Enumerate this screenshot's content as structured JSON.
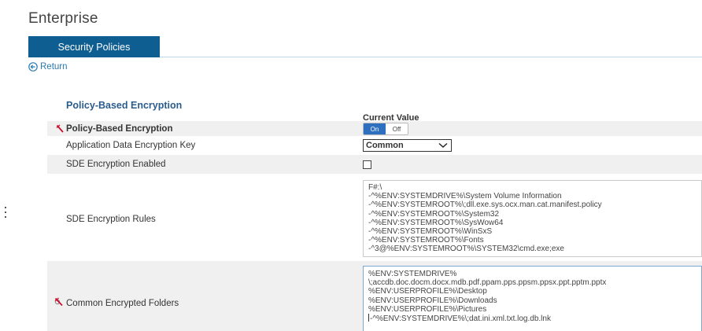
{
  "page": {
    "title": "Enterprise"
  },
  "tabs": [
    {
      "label": "Security Policies",
      "active": true
    }
  ],
  "nav": {
    "return_label": "Return"
  },
  "section": {
    "title": "Policy-Based Encryption",
    "column_header": "Current Value"
  },
  "rows": {
    "policy_encryption": {
      "label": "Policy-Based Encryption",
      "toggle": {
        "on_label": "On",
        "off_label": "Off",
        "selected": "On"
      },
      "icon": "lock-icon"
    },
    "app_data_key": {
      "label": "Application Data Encryption Key",
      "value": "Common"
    },
    "sde_enabled": {
      "label": "SDE Encryption Enabled",
      "checked": false
    },
    "sde_rules": {
      "label": "SDE Encryption Rules",
      "lines": [
        "F#:\\",
        "-^%ENV:SYSTEMDRIVE%\\System Volume Information",
        "-^%ENV:SYSTEMROOT%\\;dll.exe.sys.ocx.man.cat.manifest.policy",
        "-^%ENV:SYSTEMROOT%\\System32",
        "-^%ENV:SYSTEMROOT%\\SysWow64",
        "-^%ENV:SYSTEMROOT%\\WinSxS",
        "-^%ENV:SYSTEMROOT%\\Fonts",
        "-^3@%ENV:SYSTEMROOT%\\SYSTEM32\\cmd.exe;exe"
      ]
    },
    "common_folders": {
      "label": "Common Encrypted Folders",
      "icon": "lock-icon",
      "lines": [
        "%ENV:SYSTEMDRIVE%",
        "\\;accdb.doc.docm.docx.mdb.pdf.ppam.pps.ppsm.ppsx.ppt.pptm.pptx",
        "%ENV:USERPROFILE%\\Desktop",
        "%ENV:USERPROFILE%\\Downloads",
        "%ENV:USERPROFILE%\\Pictures",
        "-^%ENV:SYSTEMDRIVE%\\;dat.ini.xml.txt.log.db.lnk"
      ]
    }
  },
  "colors": {
    "tab_active": "#0f5e92",
    "link": "#2a7ab0",
    "section_title": "#2b5c8c",
    "icon_red": "#c8102e",
    "toggle_on": "#2f6fbf"
  }
}
